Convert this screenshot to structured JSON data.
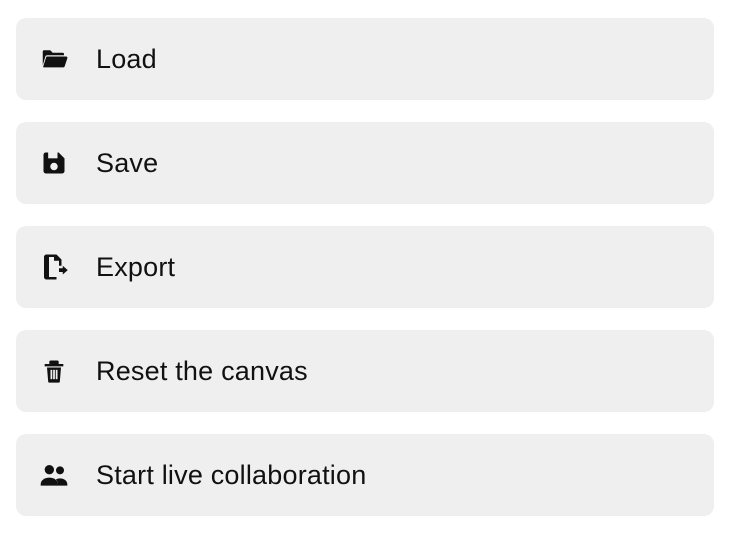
{
  "menu": {
    "items": [
      {
        "label": "Load"
      },
      {
        "label": "Save"
      },
      {
        "label": "Export"
      },
      {
        "label": "Reset the canvas"
      },
      {
        "label": "Start live collaboration"
      }
    ]
  }
}
